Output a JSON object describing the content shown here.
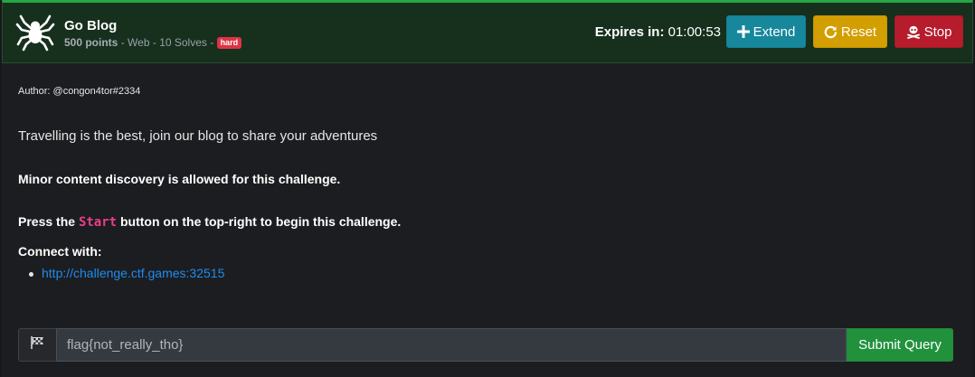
{
  "challenge": {
    "title": "Go Blog",
    "points": "500 points",
    "category": "Web",
    "solves": "10 Solves",
    "difficulty": "hard",
    "logo_icon": "spider-icon"
  },
  "timer": {
    "label": "Expires in",
    "value": "01:00:53"
  },
  "buttons": {
    "extend": "Extend",
    "reset": "Reset",
    "stop": "Stop"
  },
  "body": {
    "author": "Author: @congon4tor#2334",
    "description": "Travelling is the best, join our blog to share your adventures",
    "note": "Minor content discovery is allowed for this challenge.",
    "press_prefix": "Press the",
    "press_code": "Start",
    "press_suffix": "button on the top-right to begin this challenge.",
    "connect_label": "Connect with:",
    "link": "http://challenge.ctf.games:32515"
  },
  "flag_form": {
    "placeholder": "flag{not_really_tho}",
    "submit_label": "Submit Query",
    "icon": "flag-icon"
  },
  "colors": {
    "header_bg": "#16301d",
    "accent_green": "#27a744",
    "extend": "#17879c",
    "reset": "#d39e00",
    "stop": "#b71c2c",
    "badge": "#dc3545",
    "link": "#1f8cf0",
    "code": "#e83e8c"
  }
}
